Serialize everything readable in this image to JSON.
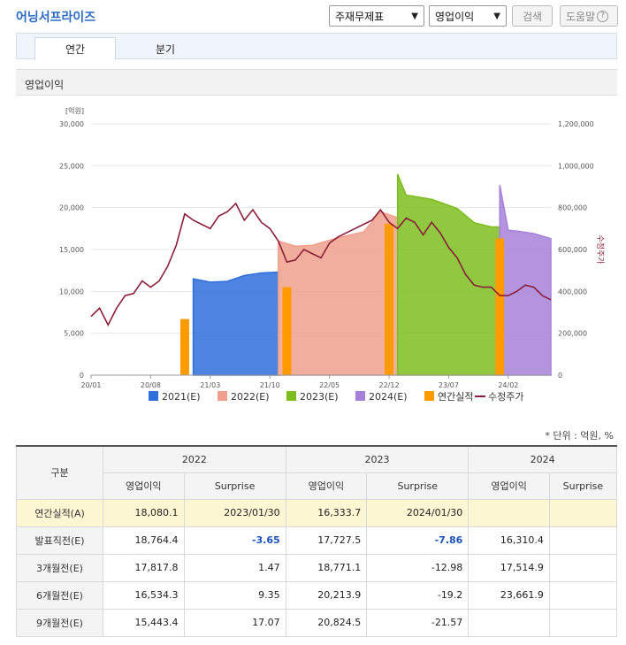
{
  "header": {
    "title": "어닝서프라이즈",
    "select_statement": "주재무제표",
    "select_item": "영업이익",
    "search_label": "검색",
    "help_label": "도움말"
  },
  "tabs": [
    {
      "label": "연간",
      "active": true
    },
    {
      "label": "분기",
      "active": false
    }
  ],
  "section_title": "영업이익",
  "unit_note": "* 단위 : 억원, %",
  "chart_data": {
    "type": "area",
    "y_left_label": "[억원]",
    "y_left_ticks": [
      "0",
      "5,000",
      "10,000",
      "15,000",
      "20,000",
      "25,000",
      "30,000"
    ],
    "y_right_label": "수정주가",
    "y_right_ticks": [
      "0",
      "200,000",
      "400,000",
      "600,000",
      "800,000",
      "1,000,000",
      "1,200,000"
    ],
    "ylim": [
      0,
      30000
    ],
    "ylim_right": [
      0,
      1200000
    ],
    "x_ticks": [
      "20/01",
      "20/08",
      "21/03",
      "21/10",
      "22/05",
      "22/12",
      "23/07",
      "24/02"
    ],
    "xlim": [
      "2020-01",
      "2024-07"
    ],
    "series": [
      {
        "name": "2021(E)",
        "color": "#2f6fdc",
        "type": "area",
        "x": [
          "2021-01",
          "2021-02",
          "2021-03",
          "2021-05",
          "2021-07",
          "2021-09",
          "2021-11"
        ],
        "y": [
          11500,
          11300,
          11100,
          11200,
          11900,
          12200,
          12300
        ]
      },
      {
        "name": "2022(E)",
        "color": "#f0a08c",
        "type": "area",
        "x": [
          "2021-11",
          "2022-01",
          "2022-03",
          "2022-06",
          "2022-09",
          "2022-11",
          "2023-01"
        ],
        "y": [
          16000,
          15400,
          15500,
          16400,
          17100,
          19500,
          18800
        ]
      },
      {
        "name": "2023(E)",
        "color": "#7dbe1e",
        "type": "area",
        "x": [
          "2023-01",
          "2023-02",
          "2023-05",
          "2023-08",
          "2023-10",
          "2023-12",
          "2024-01"
        ],
        "y": [
          24000,
          21500,
          21000,
          19900,
          18200,
          17700,
          17700
        ]
      },
      {
        "name": "2024(E)",
        "color": "#a781d9",
        "type": "area",
        "x": [
          "2024-01",
          "2024-02",
          "2024-03",
          "2024-05",
          "2024-07"
        ],
        "y": [
          22700,
          17300,
          17200,
          16900,
          16300
        ]
      },
      {
        "name": "연간실적",
        "color": "#ff9a00",
        "type": "bar",
        "x": [
          "2020-12",
          "2021-12",
          "2022-12",
          "2024-01"
        ],
        "y": [
          6700,
          10500,
          18080,
          16334
        ]
      },
      {
        "name": "수정주가",
        "color": "#8c1e3a",
        "type": "line",
        "axis": "right",
        "x": [
          "2020-01",
          "2020-02",
          "2020-03",
          "2020-04",
          "2020-05",
          "2020-06",
          "2020-07",
          "2020-08",
          "2020-09",
          "2020-10",
          "2020-11",
          "2020-12",
          "2021-01",
          "2021-02",
          "2021-03",
          "2021-04",
          "2021-05",
          "2021-06",
          "2021-07",
          "2021-08",
          "2021-09",
          "2021-10",
          "2021-11",
          "2021-12",
          "2022-01",
          "2022-02",
          "2022-03",
          "2022-04",
          "2022-05",
          "2022-06",
          "2022-07",
          "2022-08",
          "2022-09",
          "2022-10",
          "2022-11",
          "2022-12",
          "2023-01",
          "2023-02",
          "2023-03",
          "2023-04",
          "2023-05",
          "2023-06",
          "2023-07",
          "2023-08",
          "2023-09",
          "2023-10",
          "2023-11",
          "2023-12",
          "2024-01",
          "2024-02",
          "2024-03",
          "2024-04",
          "2024-05",
          "2024-06",
          "2024-07"
        ],
        "y": [
          280000,
          320000,
          240000,
          320000,
          380000,
          390000,
          450000,
          420000,
          450000,
          520000,
          620000,
          770000,
          740000,
          720000,
          700000,
          760000,
          780000,
          820000,
          740000,
          790000,
          730000,
          700000,
          640000,
          540000,
          550000,
          600000,
          580000,
          560000,
          630000,
          660000,
          680000,
          700000,
          720000,
          740000,
          790000,
          730000,
          700000,
          750000,
          730000,
          670000,
          730000,
          680000,
          610000,
          560000,
          480000,
          430000,
          420000,
          420000,
          380000,
          380000,
          400000,
          430000,
          420000,
          380000,
          360000
        ]
      }
    ]
  },
  "legend": [
    "2021(E)",
    "2022(E)",
    "2023(E)",
    "2024(E)",
    "연간실적",
    "수정주가"
  ],
  "table": {
    "corner": "구분",
    "years": [
      "2022",
      "2023",
      "2024"
    ],
    "subheaders": [
      "영업이익",
      "Surprise",
      "영업이익",
      "Surprise",
      "영업이익",
      "Surprise"
    ],
    "rows": [
      {
        "label": "연간실적(A)",
        "cells": [
          "18,080.1",
          "2023/01/30",
          "16,333.7",
          "2024/01/30",
          "",
          ""
        ],
        "actual": true
      },
      {
        "label": "발표직전(E)",
        "cells": [
          "18,764.4",
          "-3.65",
          "17,727.5",
          "-7.86",
          "16,310.4",
          ""
        ]
      },
      {
        "label": "3개월전(E)",
        "cells": [
          "17,817.8",
          "1.47",
          "18,771.1",
          "-12.98",
          "17,514.9",
          ""
        ]
      },
      {
        "label": "6개월전(E)",
        "cells": [
          "16,534.3",
          "9.35",
          "20,213.9",
          "-19.2",
          "23,661.9",
          ""
        ]
      },
      {
        "label": "9개월전(E)",
        "cells": [
          "15,443.4",
          "17.07",
          "20,824.5",
          "-21.57",
          "",
          ""
        ]
      }
    ]
  }
}
